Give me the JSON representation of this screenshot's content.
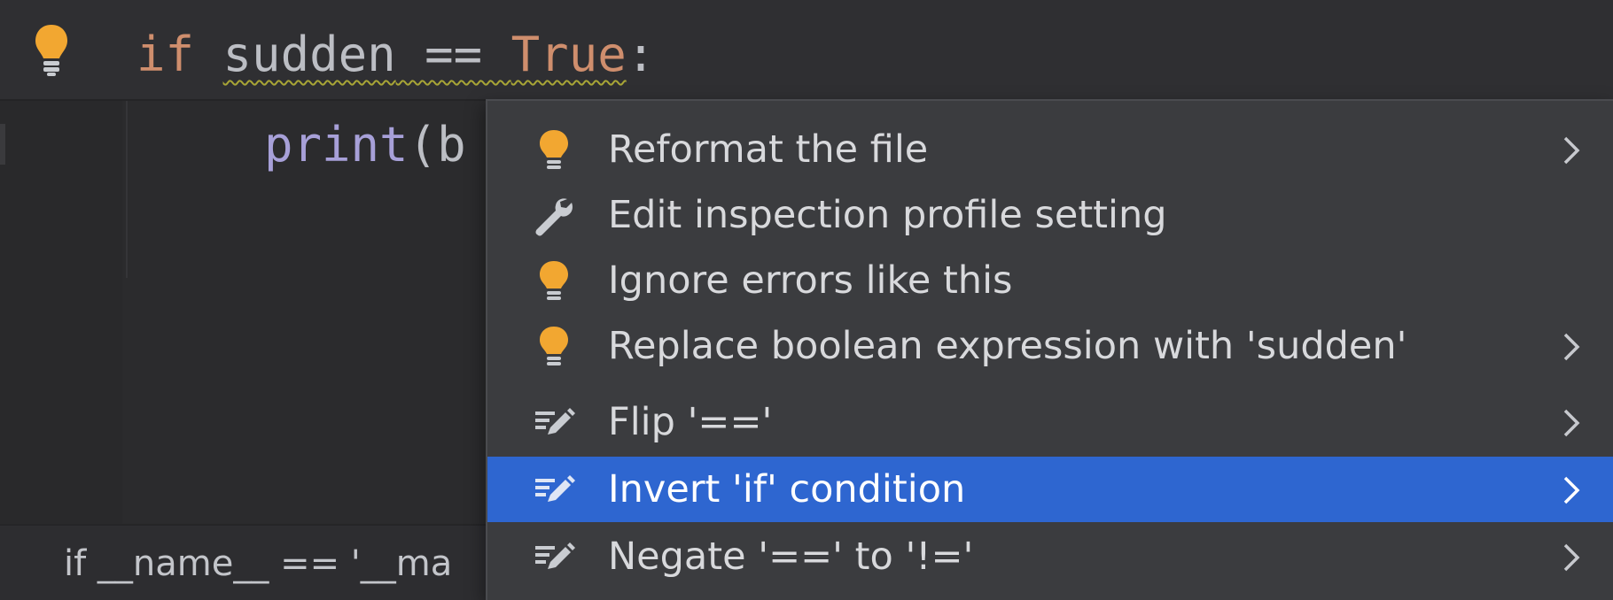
{
  "editor": {
    "line1": {
      "kw_if": "if",
      "ident": "sudden",
      "op": " == ",
      "kw_true": "True",
      "colon": ":"
    },
    "line2": {
      "func": "print",
      "rest": "(b"
    }
  },
  "breadcrumb": {
    "text": "if __name__ == '__ma"
  },
  "popup": {
    "items": [
      {
        "label": "Reformat the file",
        "icon": "bulb-icon",
        "submenu": true
      },
      {
        "label": "Edit inspection profile setting",
        "icon": "wrench-icon",
        "submenu": false
      },
      {
        "label": "Ignore errors like this",
        "icon": "bulb-icon",
        "submenu": false
      },
      {
        "label": "Replace boolean expression with 'sudden'",
        "icon": "bulb-icon",
        "submenu": true
      },
      {
        "label": "Flip '=='",
        "icon": "intention-icon",
        "submenu": true
      },
      {
        "label": "Invert 'if' condition",
        "icon": "intention-icon",
        "submenu": true,
        "selected": true
      },
      {
        "label": "Negate '==' to '!='",
        "icon": "intention-icon",
        "submenu": true
      }
    ]
  },
  "colors": {
    "selection": "#2e66d0",
    "bulb": "#f2a731",
    "keyword": "#cf8e6d"
  }
}
